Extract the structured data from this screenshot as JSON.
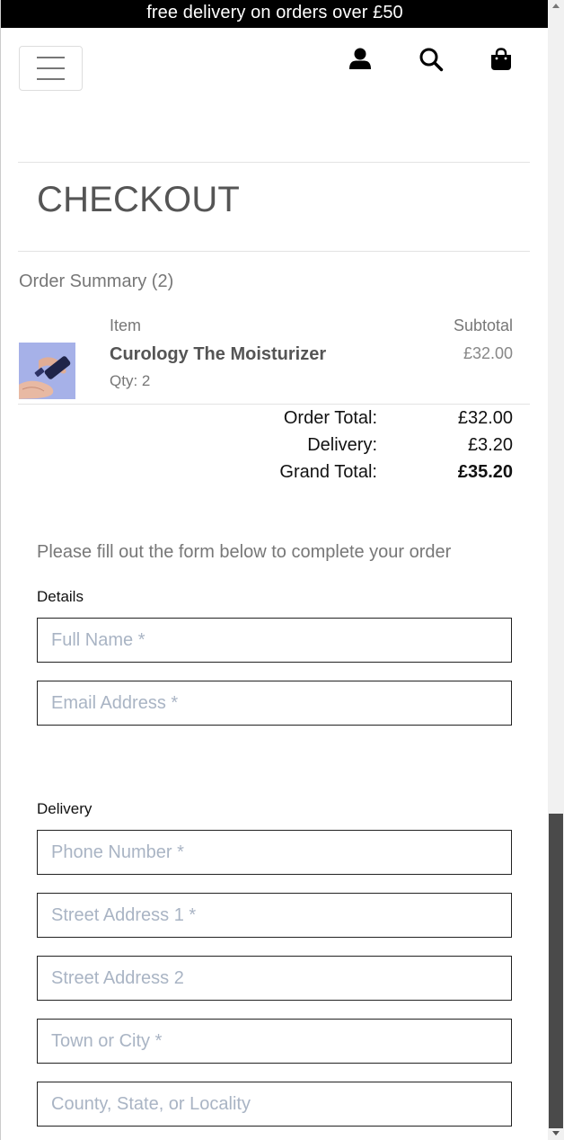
{
  "banner": {
    "text": "free delivery on orders over £50"
  },
  "header": {
    "icons": [
      "menu-icon",
      "user-icon",
      "search-icon",
      "bag-icon"
    ]
  },
  "page": {
    "title": "CHECKOUT"
  },
  "summary": {
    "heading": "Order Summary (2)",
    "col_item": "Item",
    "col_subtotal": "Subtotal",
    "items": [
      {
        "name": "Curology The Moisturizer",
        "qty": "Qty: 2",
        "subtotal": "£32.00"
      }
    ],
    "totals": {
      "order_total_label": "Order Total:",
      "order_total_value": "£32.00",
      "delivery_label": "Delivery:",
      "delivery_value": "£3.20",
      "grand_total_label": "Grand Total:",
      "grand_total_value": "£35.20"
    }
  },
  "form": {
    "intro": "Please fill out the form below to complete your order",
    "details_label": "Details",
    "delivery_label": "Delivery",
    "full_name_placeholder": "Full Name *",
    "email_placeholder": "Email Address *",
    "phone_placeholder": "Phone Number *",
    "street1_placeholder": "Street Address 1 *",
    "street2_placeholder": "Street Address 2",
    "town_placeholder": "Town or City *",
    "county_placeholder": "County, State, or Locality"
  },
  "colors": {
    "banner_bg": "#000000",
    "placeholder": "#a9b4c4",
    "text_muted": "#777777"
  }
}
